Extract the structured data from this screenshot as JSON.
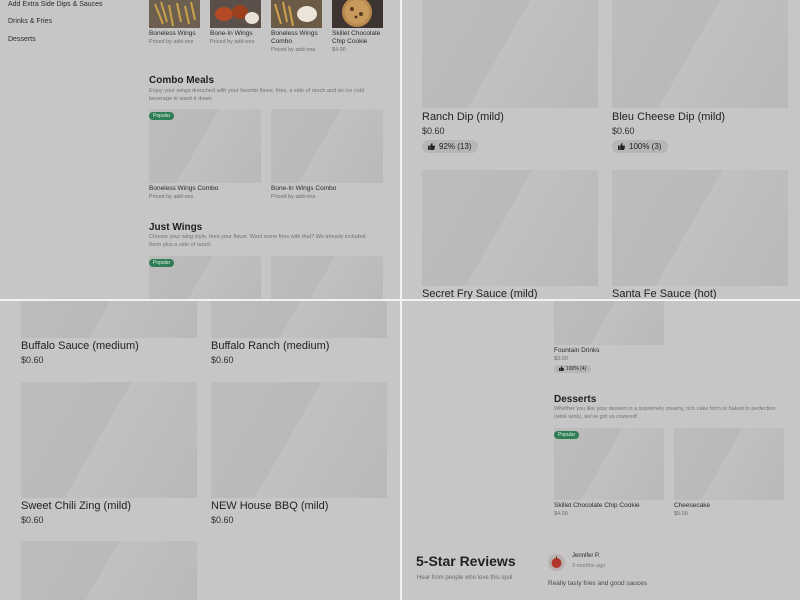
{
  "sidebar": {
    "items": [
      "Add Extra Side Dips & Sauces",
      "Drinks & Fries",
      "Desserts"
    ]
  },
  "menu_top": {
    "items": [
      {
        "name": "Boneless Wings",
        "price": "Priced by add-ons"
      },
      {
        "name": "Bone-In Wings",
        "price": "Priced by add-ons"
      },
      {
        "name_line1": "Boneless Wings",
        "name_line2": "Combo",
        "price": "Priced by add-ons"
      },
      {
        "name_line1": "Skillet Chocolate",
        "name_line2": "Chip Cookie",
        "price": "$4.00"
      }
    ]
  },
  "combo": {
    "title": "Combo Meals",
    "description": "Enjoy your wings drenched with your favorite flavor, fries, a side of ranch and an ice cold beverage to wash it down.",
    "items": [
      {
        "name": "Boneless Wings Combo",
        "price": "Priced by add-ons",
        "badge": "Popular"
      },
      {
        "name": "Bone-In Wings Combo",
        "price": "Priced by add-ons"
      }
    ]
  },
  "just_wings": {
    "title": "Just Wings",
    "description": "Choose your wing style, then your flavor. Want some fries with that? We already included them plus a side of ranch.",
    "badge": "Popular"
  },
  "sauces": {
    "items": [
      {
        "name": "Ranch Dip (mild)",
        "price": "$0.60",
        "rating": "92% (13)"
      },
      {
        "name": "Bleu Cheese Dip (mild)",
        "price": "$0.60",
        "rating": "100% (3)"
      },
      {
        "name": "Secret Fry Sauce (mild)"
      },
      {
        "name": "Santa Fe Sauce (hot)"
      },
      {
        "name": "Buffalo Sauce (medium)",
        "price": "$0.60"
      },
      {
        "name": "Buffalo Ranch (medium)",
        "price": "$0.60"
      },
      {
        "name": "Sweet Chili Zing (mild)",
        "price": "$0.60"
      },
      {
        "name": "NEW House BBQ (mild)",
        "price": "$0.60"
      }
    ]
  },
  "drinks": {
    "item": {
      "name": "Fountain Drinks",
      "price": "$3.00",
      "rating": "100% (4)"
    }
  },
  "desserts": {
    "title": "Desserts",
    "description": "Whether you like your dessert in a supremely creamy, rich cake form or baked to perfection (wink wink), we've got ya covered!",
    "items": [
      {
        "name": "Skillet Chocolate Chip Cookie",
        "price": "$4.00",
        "badge": "Popular"
      },
      {
        "name": "Cheesecake",
        "price": "$5.00"
      }
    ]
  },
  "reviews": {
    "title": "5-Star Reviews",
    "subtitle": "Hear from people who love this spot",
    "review": {
      "author": "Jennifer P.",
      "time": "3 months ago",
      "text": "Really tasty fries and good sauces"
    }
  },
  "colors": {
    "badge": "#2f7d54",
    "overlay": "#c6c6c6",
    "avatar": "#c0392b"
  },
  "icons": {
    "rating": "thumbs-up-icon"
  }
}
